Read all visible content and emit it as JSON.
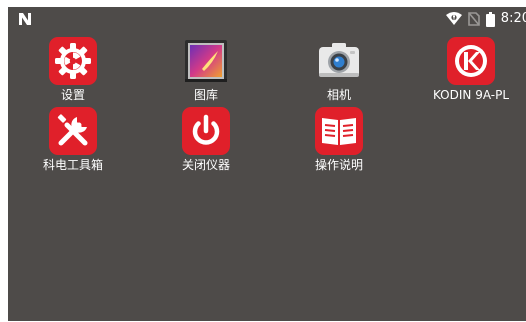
{
  "status_bar": {
    "time": "8:20",
    "icons": [
      "notification-n-icon",
      "wifi-off-icon",
      "no-sim-icon",
      "battery-icon"
    ]
  },
  "apps": [
    {
      "label": "设置",
      "icon": "settings-gear-icon"
    },
    {
      "label": "图库",
      "icon": "gallery-icon"
    },
    {
      "label": "相机",
      "icon": "camera-icon"
    },
    {
      "label": "KODIN 9A-PL",
      "icon": "kodin-logo-icon"
    },
    {
      "label": "科电工具箱",
      "icon": "toolbox-icon"
    },
    {
      "label": "关闭仪器",
      "icon": "power-icon"
    },
    {
      "label": "操作说明",
      "icon": "manual-book-icon"
    }
  ],
  "colors": {
    "background": "#4e4b49",
    "app_red": "#e0202a",
    "text": "#ffffff"
  }
}
